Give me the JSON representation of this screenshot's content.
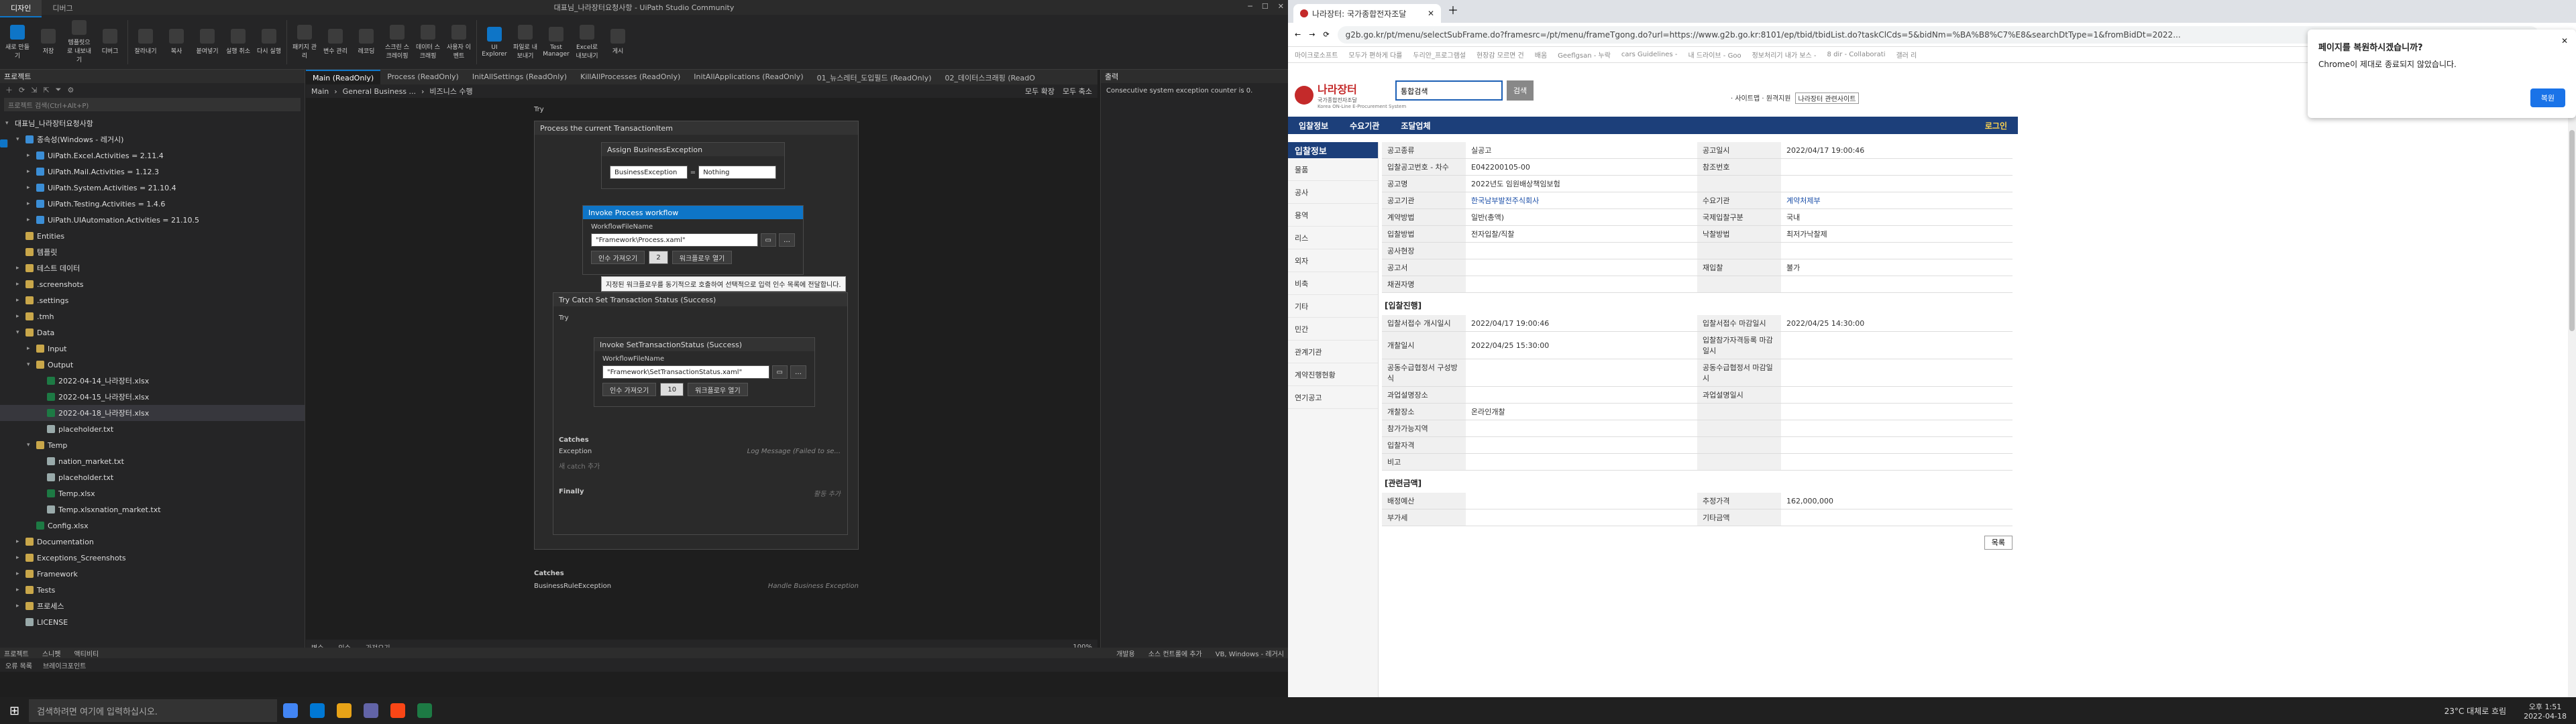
{
  "studio": {
    "title": "대표님_나라장터요청사항 - UiPath Studio Community",
    "top_tabs": [
      "디자인",
      "디버그"
    ],
    "ribbon": [
      {
        "label": "새로 만들기"
      },
      {
        "label": "저장"
      },
      {
        "label": "템플릿으로 내보내기"
      },
      {
        "label": "디버그"
      },
      {
        "label": "잘라내기"
      },
      {
        "label": "복사"
      },
      {
        "label": "붙여넣기"
      },
      {
        "label": "실행 취소"
      },
      {
        "label": "다시 실행"
      },
      {
        "label": "패키지 관리"
      },
      {
        "label": "변수 관리"
      },
      {
        "label": "레코딩"
      },
      {
        "label": "스크린 스크레이핑"
      },
      {
        "label": "데이터 스크래핑"
      },
      {
        "label": "사용자 이벤트"
      },
      {
        "label": "UI Explorer"
      },
      {
        "label": "파일로 내보내기"
      },
      {
        "label": "Test Manager"
      },
      {
        "label": "Excel로 내보내기"
      },
      {
        "label": "게시"
      }
    ],
    "project_panel": {
      "title": "프로젝트",
      "search_placeholder": "프로젝트 검색(Ctrl+Alt+P)",
      "tree": [
        {
          "label": "대표님_나라장터요청사항",
          "icon": "proj",
          "level": 0,
          "exp": "▾"
        },
        {
          "label": "종속성(Windows - 레거시)",
          "icon": "pkg",
          "level": 1,
          "exp": "▾"
        },
        {
          "label": "UiPath.Excel.Activities = 2.11.4",
          "icon": "pkg",
          "level": 2,
          "exp": "▸"
        },
        {
          "label": "UiPath.Mail.Activities = 1.12.3",
          "icon": "pkg",
          "level": 2,
          "exp": "▸"
        },
        {
          "label": "UiPath.System.Activities = 21.10.4",
          "icon": "pkg",
          "level": 2,
          "exp": "▸"
        },
        {
          "label": "UiPath.Testing.Activities = 1.4.6",
          "icon": "pkg",
          "level": 2,
          "exp": "▸"
        },
        {
          "label": "UiPath.UIAutomation.Activities = 21.10.5",
          "icon": "pkg",
          "level": 2,
          "exp": "▸"
        },
        {
          "label": "Entities",
          "icon": "folder",
          "level": 1,
          "exp": ""
        },
        {
          "label": "템플릿",
          "icon": "folder",
          "level": 1,
          "exp": ""
        },
        {
          "label": "테스트 데이터",
          "icon": "folder",
          "level": 1,
          "exp": "▸"
        },
        {
          "label": ".screenshots",
          "icon": "folder",
          "level": 1,
          "exp": "▸"
        },
        {
          "label": ".settings",
          "icon": "folder",
          "level": 1,
          "exp": "▸"
        },
        {
          "label": ".tmh",
          "icon": "folder",
          "level": 1,
          "exp": "▸"
        },
        {
          "label": "Data",
          "icon": "folder",
          "level": 1,
          "exp": "▾"
        },
        {
          "label": "Input",
          "icon": "folder",
          "level": 2,
          "exp": "▸"
        },
        {
          "label": "Output",
          "icon": "folder",
          "level": 2,
          "exp": "▾"
        },
        {
          "label": "2022-04-14_나라장터.xlsx",
          "icon": "xls",
          "level": 3,
          "exp": ""
        },
        {
          "label": "2022-04-15_나라장터.xlsx",
          "icon": "xls",
          "level": 3,
          "exp": ""
        },
        {
          "label": "2022-04-18_나라장터.xlsx",
          "icon": "xls",
          "level": 3,
          "exp": "",
          "sel": true
        },
        {
          "label": "placeholder.txt",
          "icon": "txt",
          "level": 3,
          "exp": ""
        },
        {
          "label": "Temp",
          "icon": "folder",
          "level": 2,
          "exp": "▾"
        },
        {
          "label": "nation_market.txt",
          "icon": "txt",
          "level": 3,
          "exp": ""
        },
        {
          "label": "placeholder.txt",
          "icon": "txt",
          "level": 3,
          "exp": ""
        },
        {
          "label": "Temp.xlsx",
          "icon": "xls",
          "level": 3,
          "exp": ""
        },
        {
          "label": "Temp.xlsxnation_market.txt",
          "icon": "txt",
          "level": 3,
          "exp": ""
        },
        {
          "label": "Config.xlsx",
          "icon": "xls",
          "level": 2,
          "exp": ""
        },
        {
          "label": "Documentation",
          "icon": "folder",
          "level": 1,
          "exp": "▸"
        },
        {
          "label": "Exceptions_Screenshots",
          "icon": "folder",
          "level": 1,
          "exp": "▸"
        },
        {
          "label": "Framework",
          "icon": "folder",
          "level": 1,
          "exp": "▸"
        },
        {
          "label": "Tests",
          "icon": "folder",
          "level": 1,
          "exp": "▸"
        },
        {
          "label": "프로세스",
          "icon": "folder",
          "level": 1,
          "exp": "▸"
        },
        {
          "label": "LICENSE",
          "icon": "txt",
          "level": 1,
          "exp": ""
        }
      ]
    },
    "doc_tabs": [
      "Main (ReadOnly)",
      "Process (ReadOnly)",
      "InitAllSettings (ReadOnly)",
      "KillAllProcesses (ReadOnly)",
      "InitAllApplications (ReadOnly)",
      "01_뉴스레터_도입필드 (ReadOnly)",
      "02_데이터스크래핑 (ReadO"
    ],
    "breadcrumb": [
      "Main",
      "General Business ...",
      "비즈니스 수행"
    ],
    "breadcrumb_right": [
      "모두 확장",
      "모두 축소"
    ],
    "try_label": "Try",
    "seq_title": "Process the current TransactionItem",
    "assign": {
      "title": "Assign BusinessException",
      "left": "BusinessException",
      "eq": "=",
      "right": "Nothing"
    },
    "invoke": {
      "title": "Invoke Process workflow",
      "label": "WorkflowFileName",
      "value": "\"Framework\\Process.xaml\"",
      "btn_args": "인수 가져오기",
      "count": "2",
      "btn_open": "워크플로우 열기",
      "tooltip": "지정된 워크플로우를 동기적으로 호출하여 선택적으로 입력 인수 목록에 전달합니다."
    },
    "trycatch": {
      "title": "Try Catch Set Transaction Status (Success)",
      "try": "Try",
      "inner_title": "Invoke SetTransactionStatus (Success)",
      "label": "WorkflowFileName",
      "value": "\"Framework\\SetTransactionStatus.xaml\"",
      "btn_args": "인수 가져오기",
      "count": "10",
      "btn_open": "워크플로우 열기",
      "catches": "Catches",
      "exception": "Exception",
      "exception_hint": "Log Message (Failed to se...",
      "add_catch": "새 catch 추가",
      "finally": "Finally",
      "finally_hint": "활동 추가"
    },
    "outer_catches": "Catches",
    "outer_exc": "BusinessRuleException",
    "outer_exc_hint": "Handle Business Exception",
    "designer_bottom": [
      "변수",
      "인수",
      "가져오기"
    ],
    "zoom": "100%",
    "output": {
      "title": "출력",
      "msg": "Consecutive system exception counter is 0."
    },
    "bottom_tabs": [
      "프로젝트",
      "스니펫",
      "액티비티"
    ],
    "statusbar": [
      "오류 목록",
      "브레이크포인트"
    ],
    "statusbar_right": [
      "개발용",
      "소스 컨트롤에 추가",
      "VB, Windows - 레거시"
    ]
  },
  "browser": {
    "tab_title": "나라장터: 국가종합전자조달",
    "url": "g2b.go.kr/pt/menu/selectSubFrame.do?framesrc=/pt/menu/frameTgong.do?url=https://www.g2b.go.kr:8101/ep/tbid/tbidList.do?taskClCds=5&bidNm=%BA%B8%C7%E8&searchDtType=1&fromBidDt=2022...",
    "bookmarks": [
      "마이크로소프트",
      "모두가 편하게 다를",
      "두리안_프로그램설",
      "현장감 모르면 건",
      "배움",
      "Geeflgsan - 누락",
      "cars Guidelines -",
      "내 드라이브 - Goo",
      "정보처리기 내가 보스 -",
      "8 dir - Collaborati",
      "갤러 리"
    ],
    "logo_text": "나라장터",
    "logo_sub": "국가종합전자조달",
    "logo_en": "Korea ON-Line E-Procurement System",
    "search_select": "통합검색",
    "search_btn": "검색",
    "top_links": "· 사이트맵 · 원격지원",
    "site_select": "나라장터 관련사이트",
    "login": "로그인",
    "nav": [
      "입찰정보",
      "수요기관",
      "조달업체"
    ],
    "side_title": "입찰정보",
    "side_items": [
      "물품",
      "공사",
      "용역",
      "리스",
      "외자",
      "비축",
      "기타",
      "민간",
      "관계기관",
      "계약진행현황",
      "연기공고"
    ],
    "bid_rows": [
      [
        "공고종류",
        "실공고",
        "공고일시",
        "2022/04/17 19:00:46"
      ],
      [
        "입찰공고번호 - 차수",
        "E042200105-00",
        "참조번호",
        ""
      ],
      [
        "공고명",
        "2022년도 임원배상책임보험",
        "",
        ""
      ],
      [
        "공고기관",
        "한국남부발전주식회사",
        "수요기관",
        "계약처제부"
      ],
      [
        "계약방법",
        "일반(총액)",
        "국제입찰구분",
        "국내"
      ],
      [
        "입찰방법",
        "전자입찰/직찰",
        "낙찰방법",
        "최저가낙찰제"
      ],
      [
        "공사현장",
        "",
        "",
        ""
      ],
      [
        "공고서",
        "",
        "재입찰",
        "불가"
      ],
      [
        "채권자명",
        "",
        "",
        ""
      ]
    ],
    "sec2": "[입찰진행]",
    "prog_rows": [
      [
        "입찰서접수 개시일시",
        "2022/04/17 19:00:46",
        "입찰서접수 마감일시",
        "2022/04/25 14:30:00"
      ],
      [
        "개찰일시",
        "2022/04/25 15:30:00",
        "입찰참가자격등록 마감일시",
        ""
      ],
      [
        "공동수급협정서 구성방식",
        "",
        "공동수급협정서 마감일시",
        ""
      ],
      [
        "과업설명장소",
        "",
        "과업설명일시",
        ""
      ],
      [
        "개찰장소",
        "온라인개찰",
        "",
        ""
      ],
      [
        "참가가능지역",
        "",
        "",
        ""
      ],
      [
        "입찰자격",
        "",
        "",
        ""
      ],
      [
        "비고",
        "",
        "",
        ""
      ]
    ],
    "sec3": "[관련금액]",
    "amt_rows": [
      [
        "배정예산",
        "",
        "추정가격",
        "162,000,000"
      ],
      [
        "부가세",
        "",
        "기타금액",
        ""
      ]
    ],
    "list_btn": "목록",
    "popup": {
      "title": "페이지를 복원하시겠습니까?",
      "body": "Chrome이 제대로 종료되지 않았습니다.",
      "btn": "복원"
    }
  },
  "taskbar": {
    "search": "검색하려면 여기에 입력하십시오.",
    "weather": "23°C 대체로 흐림",
    "time": "오후 1:51",
    "date": "2022-04-18",
    "time2": "오후 1:51",
    "date2": "2022-04-18"
  }
}
